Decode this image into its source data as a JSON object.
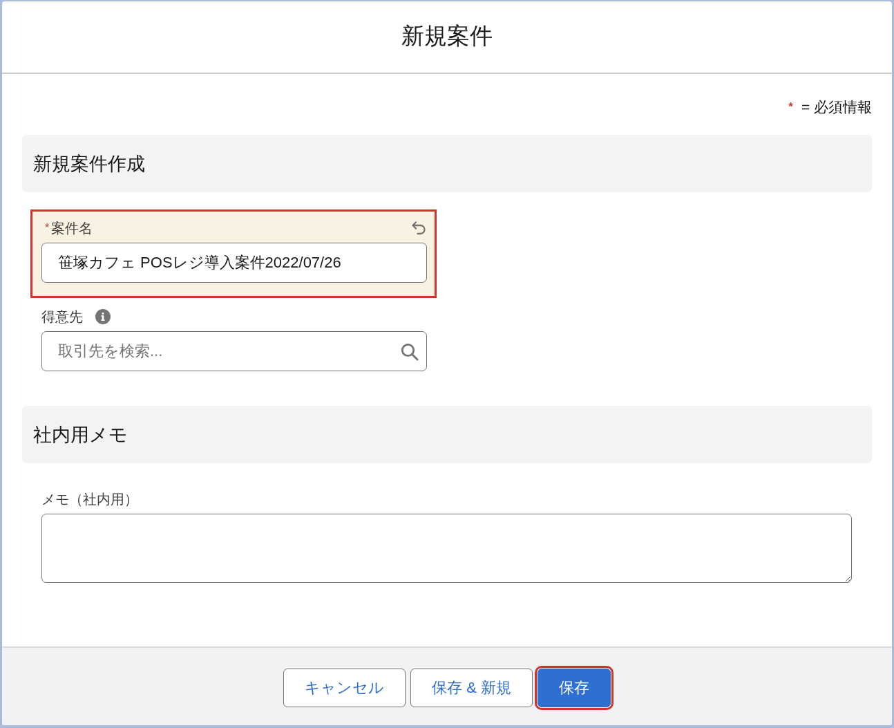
{
  "modal": {
    "title": "新規案件",
    "required_note": {
      "mark": "*",
      "text": "= 必須情報"
    }
  },
  "sections": [
    {
      "heading": "新規案件作成",
      "fields": [
        {
          "kind": "text",
          "required_mark": "*",
          "label": "案件名",
          "info": false,
          "edited": true,
          "highlighted": true,
          "value": "笹塚カフェ POSレジ導入案件2022/07/26"
        },
        {
          "kind": "lookup",
          "label": "得意先",
          "info": true,
          "edited": false,
          "highlighted": false,
          "placeholder": "取引先を検索..."
        }
      ]
    },
    {
      "heading": "社内用メモ",
      "fields": [
        {
          "kind": "textarea",
          "label": "メモ（社内用）",
          "info": false,
          "edited": false,
          "highlighted": false
        }
      ]
    }
  ],
  "buttons": [
    {
      "label": "キャンセル",
      "kind": "neutral",
      "highlighted": false
    },
    {
      "label": "保存 & 新規",
      "kind": "neutral",
      "highlighted": false
    },
    {
      "label": "保存",
      "kind": "brand",
      "highlighted": true
    }
  ]
}
